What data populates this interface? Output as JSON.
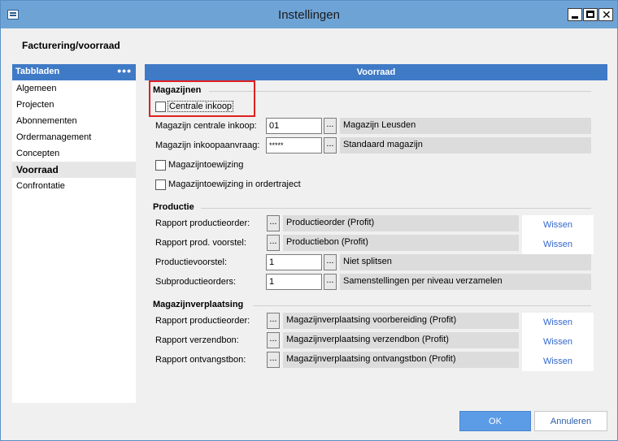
{
  "window": {
    "title": "Instellingen"
  },
  "section_title": "Facturering/voorraad",
  "sidebar": {
    "header": "Tabbladen",
    "menu_dots": "•••",
    "items": [
      {
        "label": "Algemeen"
      },
      {
        "label": "Projecten"
      },
      {
        "label": "Abonnementen"
      },
      {
        "label": "Ordermanagement"
      },
      {
        "label": "Concepten"
      },
      {
        "label": "Voorraad",
        "active": true
      },
      {
        "label": "Confrontatie"
      }
    ]
  },
  "panel": {
    "header": "Voorraad",
    "magazijnen": {
      "title": "Magazijnen",
      "centrale_inkoop": {
        "label": "Centrale inkoop",
        "checked": false
      },
      "magazijn_centrale_inkoop": {
        "label": "Magazijn centrale inkoop:",
        "value": "01",
        "ellipsis": "...",
        "description": "Magazijn Leusden"
      },
      "magazijn_inkoopaanvraag": {
        "label": "Magazijn inkoopaanvraag:",
        "value": "*****",
        "ellipsis": "...",
        "description": "Standaard magazijn"
      },
      "magazijntoewijzing": {
        "label": "Magazijntoewijzing",
        "checked": false
      },
      "magazijntoewijzing_ordertraject": {
        "label": "Magazijntoewijzing in ordertraject",
        "checked": false
      }
    },
    "productie": {
      "title": "Productie",
      "rapport_productieorder": {
        "label": "Rapport productieorder:",
        "ellipsis": "...",
        "value": "Productieorder (Profit)",
        "clear": "Wissen"
      },
      "rapport_prod_voorstel": {
        "label": "Rapport prod. voorstel:",
        "ellipsis": "...",
        "value": "Productiebon (Profit)",
        "clear": "Wissen"
      },
      "productievoorstel": {
        "label": "Productievoorstel:",
        "value": "1",
        "ellipsis": "...",
        "description": "Niet splitsen"
      },
      "subproductieorders": {
        "label": "Subproductieorders:",
        "value": "1",
        "ellipsis": "...",
        "description": "Samenstellingen per niveau verzamelen"
      }
    },
    "magazijnverplaatsing": {
      "title": "Magazijnverplaatsing",
      "rapport_productieorder": {
        "label": "Rapport productieorder:",
        "ellipsis": "...",
        "value": "Magazijnverplaatsing voorbereiding (Profit)",
        "clear": "Wissen"
      },
      "rapport_verzendbon": {
        "label": "Rapport verzendbon:",
        "ellipsis": "...",
        "value": "Magazijnverplaatsing verzendbon (Profit)",
        "clear": "Wissen"
      },
      "rapport_ontvangstbon": {
        "label": "Rapport ontvangstbon:",
        "ellipsis": "...",
        "value": "Magazijnverplaatsing ontvangstbon (Profit)",
        "clear": "Wissen"
      }
    }
  },
  "buttons": {
    "ok": "OK",
    "cancel": "Annuleren"
  },
  "colors": {
    "accent": "#3f7ac6",
    "titlebar": "#6ea3d6",
    "highlight": "#e02020",
    "link": "#3366cc",
    "ok_button": "#5c9ce6"
  }
}
